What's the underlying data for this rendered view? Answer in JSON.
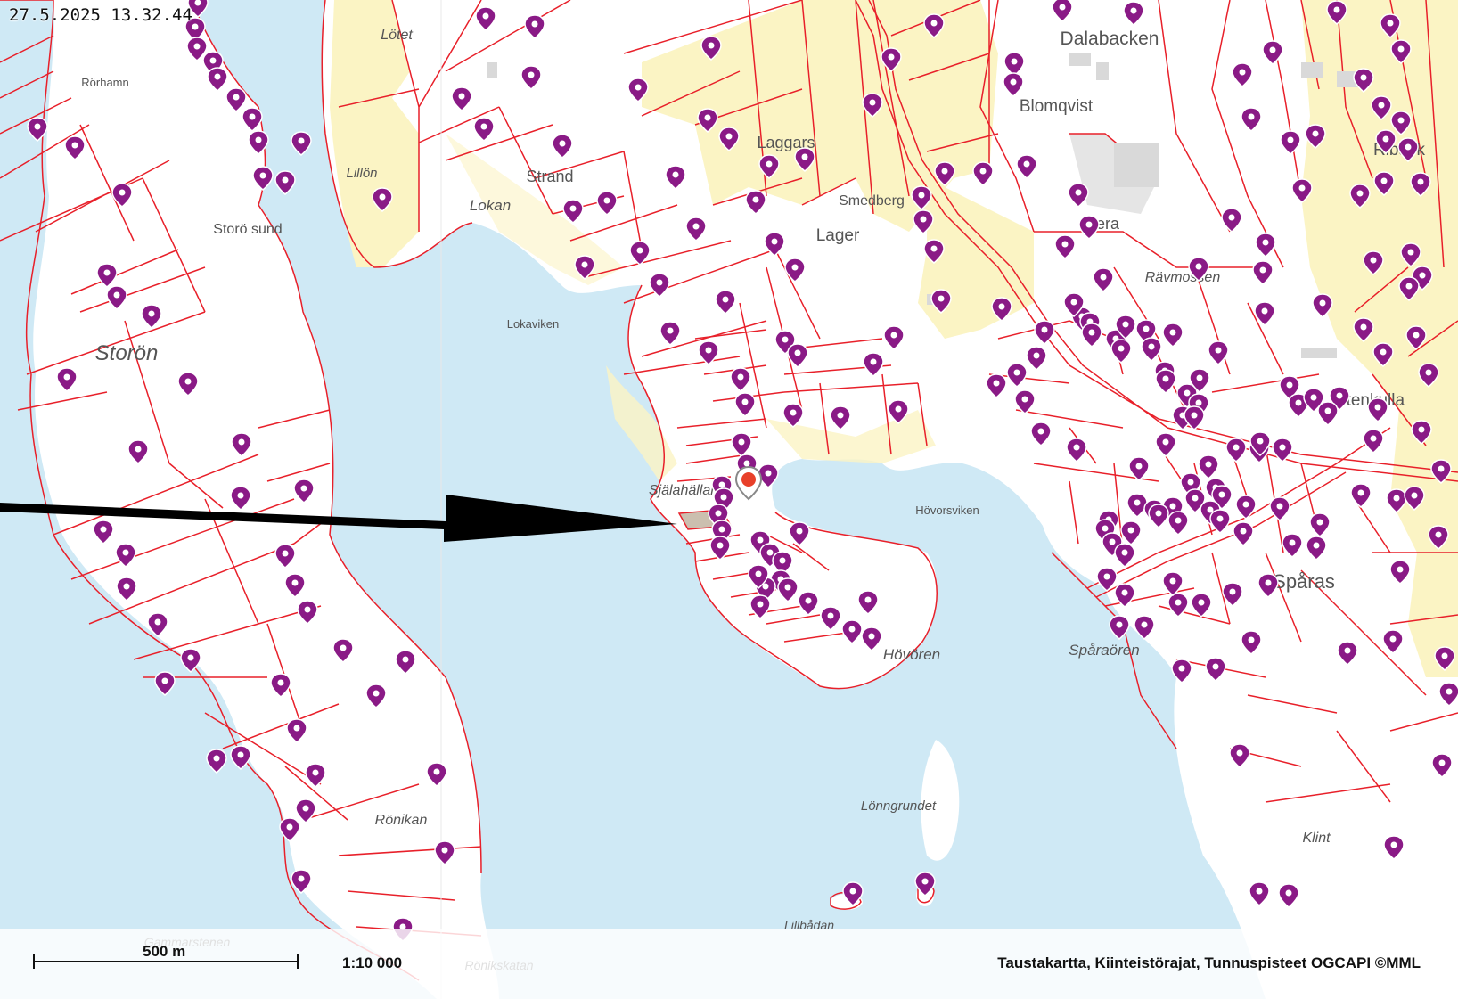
{
  "timestamp": "27.5.2025 13.32.44",
  "place_labels": [
    {
      "text": "Lötet",
      "italic": true
    },
    {
      "text": "Dalabacken",
      "italic": false
    },
    {
      "text": "Rörhamn",
      "italic": false
    },
    {
      "text": "Blomqvist",
      "italic": false
    },
    {
      "text": "Laggars",
      "italic": false
    },
    {
      "text": "Riback",
      "italic": false
    },
    {
      "text": "Strand",
      "italic": false
    },
    {
      "text": "Lillön",
      "italic": true
    },
    {
      "text": "Smedberg",
      "italic": false
    },
    {
      "text": "Lokan",
      "italic": true
    },
    {
      "text": "Storö sund",
      "italic": false
    },
    {
      "text": "Lager",
      "italic": false
    },
    {
      "text": "Bera",
      "italic": false
    },
    {
      "text": "Rävmossen",
      "italic": true
    },
    {
      "text": "Lokaviken",
      "italic": false
    },
    {
      "text": "Storön",
      "italic": true
    },
    {
      "text": "Stenkulla",
      "italic": false
    },
    {
      "text": "Själahällan",
      "italic": true
    },
    {
      "text": "Hövorsviken",
      "italic": false
    },
    {
      "text": "Spåras",
      "italic": false
    },
    {
      "text": "Spåraören",
      "italic": true
    },
    {
      "text": "Hövören",
      "italic": true
    },
    {
      "text": "Lönngrundet",
      "italic": true
    },
    {
      "text": "Rönikan",
      "italic": true
    },
    {
      "text": "Klint",
      "italic": true
    },
    {
      "text": "Lillbådan",
      "italic": true
    },
    {
      "text": "Gammarstenen",
      "italic": true
    },
    {
      "text": "Rönikskatan",
      "italic": true
    }
  ],
  "scale": {
    "distance_label": "500 m",
    "ratio": "1:10 000"
  },
  "attribution": "Taustakartta, Kiinteistörajat, Tunnuspisteet OGCAPI ©MML",
  "colors": {
    "water": "#cfe9f5",
    "land": "#ffffff",
    "fields": "#fbf4c4",
    "boundary": "#e8202a",
    "marker": "#8a1a86",
    "selected_marker": "#e8402a",
    "arrow": "#000000"
  },
  "markers_icon": "map-pin-icon"
}
